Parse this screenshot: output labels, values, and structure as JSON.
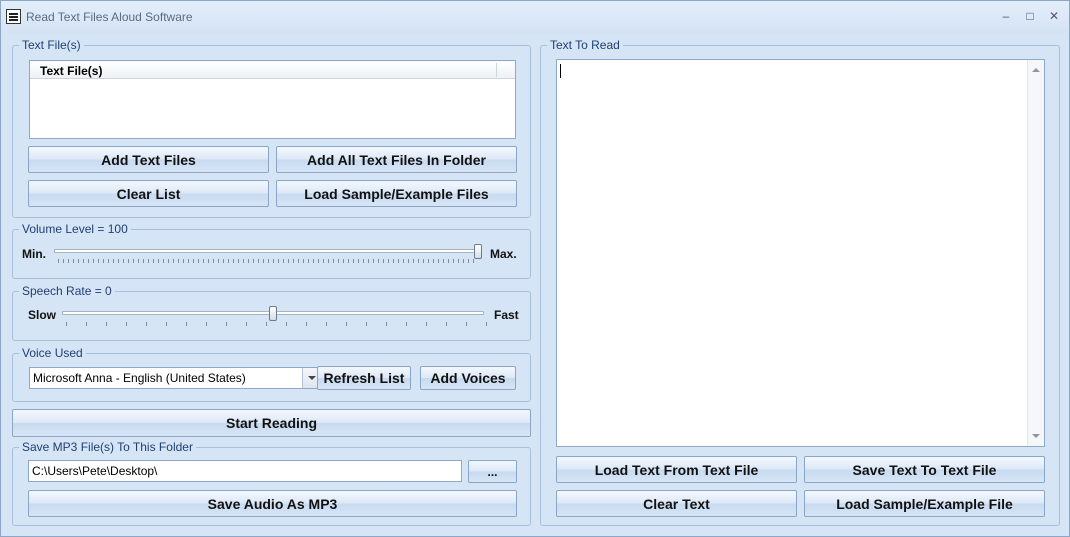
{
  "window": {
    "title": "Read Text Files Aloud Software",
    "minimize": "–",
    "maximize": "□",
    "close": "✕"
  },
  "text_files_group": {
    "label": "Text File(s)",
    "list_header": "Text File(s)",
    "add_text_files": "Add Text Files",
    "add_all_in_folder": "Add All Text Files In Folder",
    "clear_list": "Clear List",
    "load_sample": "Load Sample/Example Files"
  },
  "volume_group": {
    "label": "Volume Level = 100",
    "min_label": "Min.",
    "max_label": "Max.",
    "value_fraction": 1.0
  },
  "speech_rate_group": {
    "label": "Speech Rate = 0",
    "slow_label": "Slow",
    "fast_label": "Fast",
    "value_fraction": 0.5
  },
  "voice_group": {
    "label": "Voice Used",
    "selected_voice": "Microsoft Anna - English (United States)",
    "refresh_list": "Refresh List",
    "add_voices": "Add Voices"
  },
  "start_reading": "Start Reading",
  "save_mp3_group": {
    "label": "Save MP3 File(s) To This Folder",
    "folder_path": "C:\\Users\\Pete\\Desktop\\",
    "browse": "...",
    "save_audio": "Save Audio As MP3"
  },
  "text_to_read_group": {
    "label": "Text To Read",
    "content": "",
    "load_from_file": "Load Text From Text File",
    "save_to_file": "Save Text To Text File",
    "clear_text": "Clear Text",
    "load_sample": "Load Sample/Example File"
  }
}
